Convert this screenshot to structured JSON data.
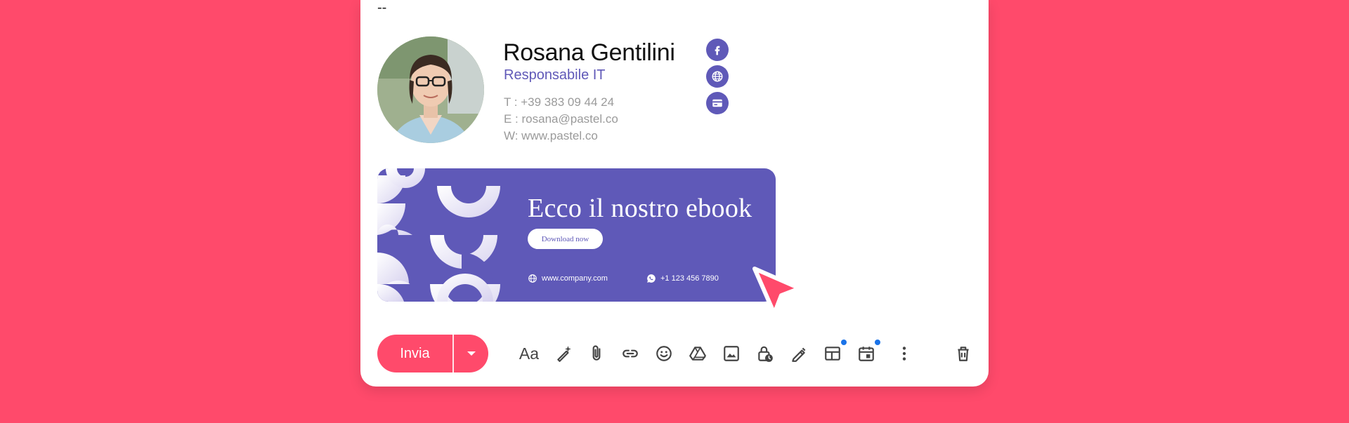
{
  "signature": {
    "separator": "--",
    "name": "Rosana Gentilini",
    "role": "Responsabile IT",
    "phone": "T : +39 383 09 44 24",
    "email": "E : rosana@pastel.co",
    "website": "W: www.pastel.co",
    "social_icons": [
      "facebook-icon",
      "globe-icon",
      "card-icon"
    ]
  },
  "banner": {
    "title": "Ecco il nostro ebook",
    "button_label": "Download now",
    "website": "www.company.com",
    "phone": "+1 123 456 7890"
  },
  "toolbar": {
    "send_label": "Invia",
    "icons": [
      "text-format-icon",
      "magic-pen-icon",
      "attach-icon",
      "link-icon",
      "emoji-icon",
      "drive-icon",
      "image-icon",
      "lock-clock-icon",
      "signature-pen-icon",
      "layout-icon",
      "schedule-icon",
      "more-icon",
      "trash-icon"
    ]
  },
  "colors": {
    "background": "#ff4a6b",
    "accent": "#5f59b8",
    "notification_dot": "#1a73e8"
  }
}
